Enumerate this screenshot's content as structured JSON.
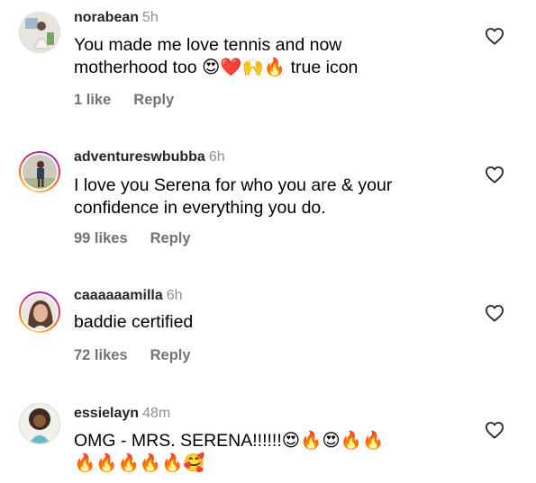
{
  "comments": [
    {
      "username": "norabean",
      "time": "5h",
      "text_lines": [
        "You made me love tennis and now",
        "motherhood too 😍❤️🙌🔥 true icon"
      ],
      "likes": "1 like",
      "reply": "Reply",
      "avatar_ring": "none",
      "avatar_icon": "user-avatar-icon"
    },
    {
      "username": "adventureswbubba",
      "time": "6h",
      "text_lines": [
        "I love you Serena for who you are & your",
        "confidence in everything you do."
      ],
      "likes": "99 likes",
      "reply": "Reply",
      "avatar_ring": "story",
      "avatar_icon": "user-avatar-icon"
    },
    {
      "username": "caaaaaamilla",
      "time": "6h",
      "text_lines": [
        "baddie certified"
      ],
      "likes": "72 likes",
      "reply": "Reply",
      "avatar_ring": "story",
      "avatar_icon": "user-avatar-icon"
    },
    {
      "username": "essielayn",
      "time": "48m",
      "text_lines": [
        "OMG - MRS. SERENA!!!!!!😍🔥😍🔥🔥",
        "🔥🔥🔥🔥🔥🥰"
      ],
      "likes": "",
      "reply": "",
      "avatar_ring": "none",
      "avatar_icon": "user-avatar-icon"
    }
  ],
  "colors": {
    "username": "#262626",
    "muted": "#8e8e8e",
    "meta": "#737373",
    "text": "#000000",
    "heart_stroke": "#262626",
    "story_ring_start": "#feda75",
    "story_ring_end": "#962fbf"
  },
  "icons": {
    "like": "heart-outline-icon"
  }
}
